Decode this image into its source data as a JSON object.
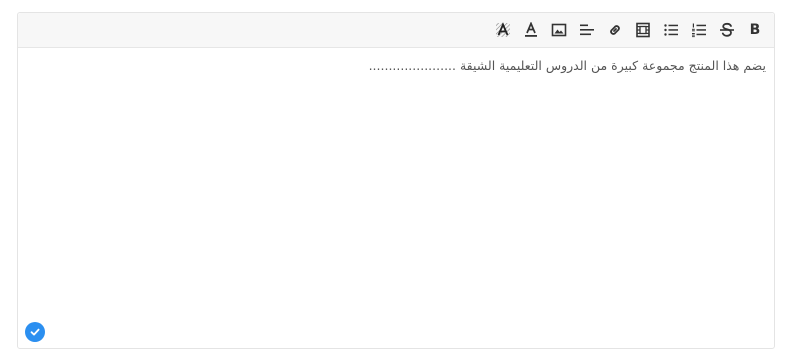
{
  "toolbar": {
    "buttons": [
      {
        "icon": "clear-format-icon"
      },
      {
        "icon": "text-color-icon"
      },
      {
        "icon": "image-icon"
      },
      {
        "icon": "align-icon"
      },
      {
        "icon": "link-icon"
      },
      {
        "icon": "video-icon"
      },
      {
        "icon": "bulleted-list-icon"
      },
      {
        "icon": "numbered-list-icon"
      },
      {
        "icon": "strikethrough-icon"
      },
      {
        "icon": "bold-icon",
        "label": "B"
      }
    ]
  },
  "editor": {
    "content": "يضم هذا المنتج مجموعة كبيرة من الدروس التعليمية الشيقة ......................"
  },
  "status": {
    "icon": "check-icon",
    "color": "#2b8ff0"
  }
}
